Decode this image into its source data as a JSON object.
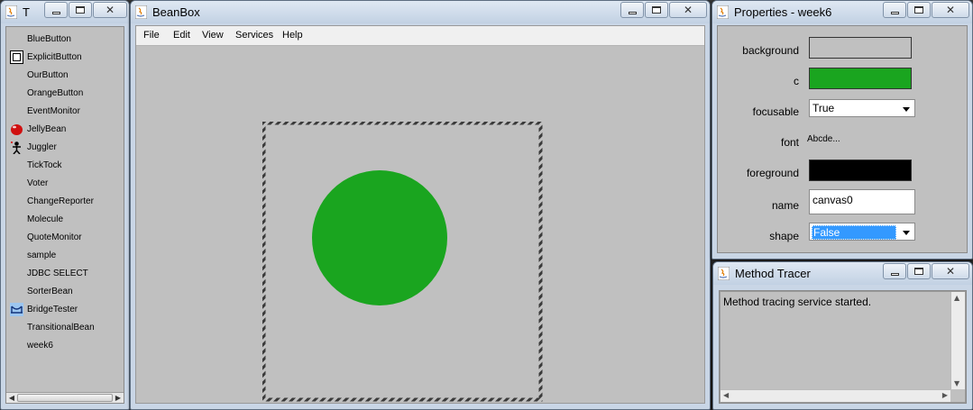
{
  "toolbox": {
    "title": "T",
    "items": [
      {
        "label": "BlueButton",
        "icon": "none"
      },
      {
        "label": "ExplicitButton",
        "icon": "button-box-icon"
      },
      {
        "label": "OurButton",
        "icon": "none"
      },
      {
        "label": "OrangeButton",
        "icon": "none"
      },
      {
        "label": "EventMonitor",
        "icon": "none"
      },
      {
        "label": "JellyBean",
        "icon": "jellybean-icon"
      },
      {
        "label": "Juggler",
        "icon": "juggler-icon"
      },
      {
        "label": "TickTock",
        "icon": "none"
      },
      {
        "label": "Voter",
        "icon": "none"
      },
      {
        "label": "ChangeReporter",
        "icon": "none"
      },
      {
        "label": "Molecule",
        "icon": "none"
      },
      {
        "label": "QuoteMonitor",
        "icon": "none"
      },
      {
        "label": "sample",
        "icon": "none"
      },
      {
        "label": "JDBC SELECT",
        "icon": "none"
      },
      {
        "label": "SorterBean",
        "icon": "none"
      },
      {
        "label": "BridgeTester",
        "icon": "bridge-icon"
      },
      {
        "label": "TransitionalBean",
        "icon": "none"
      },
      {
        "label": "week6",
        "icon": "none"
      }
    ]
  },
  "beanbox": {
    "title": "BeanBox",
    "menu": [
      "File",
      "Edit",
      "View",
      "Services",
      "Help"
    ],
    "bean": {
      "shape": "circle",
      "color": "#1aa51f"
    }
  },
  "properties": {
    "title": "Properties - week6",
    "rows": [
      {
        "label": "background",
        "kind": "color",
        "color": "#c0c0c0"
      },
      {
        "label": "c",
        "kind": "color",
        "color": "#1aa51f"
      },
      {
        "label": "focusable",
        "kind": "combo",
        "value": "True",
        "selected": false
      },
      {
        "label": "font",
        "kind": "font",
        "value": "Abcde..."
      },
      {
        "label": "foreground",
        "kind": "color",
        "color": "#000000"
      },
      {
        "label": "name",
        "kind": "text",
        "value": "canvas0"
      },
      {
        "label": "shape",
        "kind": "combo",
        "value": "False",
        "selected": true
      }
    ]
  },
  "tracer": {
    "title": "Method Tracer",
    "text": "Method tracing service started."
  }
}
